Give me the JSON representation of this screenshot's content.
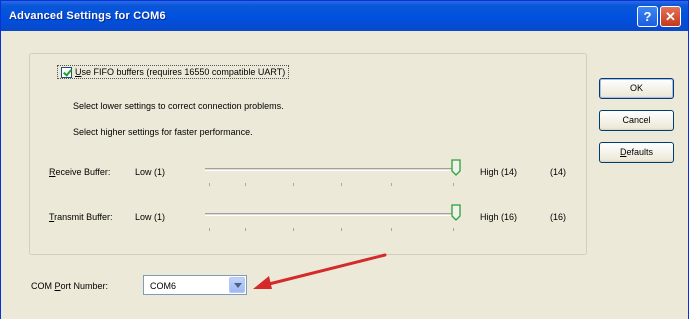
{
  "window": {
    "title": "Advanced Settings for COM6",
    "help_glyph": "?",
    "close_glyph": "✕"
  },
  "fifo": {
    "checked": true,
    "label_u": "U",
    "label_rest": "se FIFO buffers (requires 16550 compatible UART)"
  },
  "info": {
    "line1": "Select lower settings to correct connection problems.",
    "line2": "Select higher settings for faster performance."
  },
  "receive": {
    "label_u": "R",
    "label_rest": "eceive Buffer:",
    "low": "Low (1)",
    "high": "High (14)",
    "value": "(14)",
    "level": 1.0
  },
  "transmit": {
    "label_u": "T",
    "label_rest": "ransmit Buffer:",
    "low": "Low (1)",
    "high": "High (16)",
    "value": "(16)",
    "level": 1.0
  },
  "buttons": {
    "ok": "OK",
    "cancel": "Cancel",
    "defaults_u": "D",
    "defaults_rest": "efaults"
  },
  "com_port": {
    "label_pre": "COM ",
    "label_u": "P",
    "label_rest": "ort Number:",
    "value": "COM6"
  },
  "colors": {
    "titlebar": "#0a57d8",
    "annotation_arrow": "#d42a2a"
  }
}
